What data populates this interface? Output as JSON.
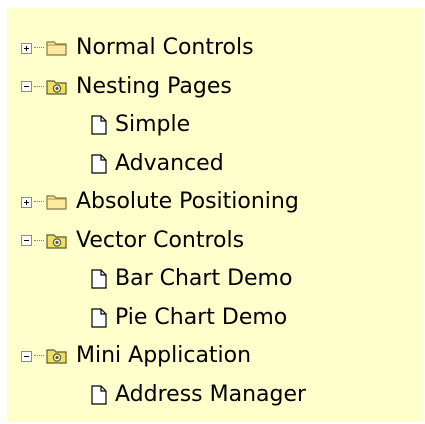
{
  "tree": {
    "items": [
      {
        "label": "Normal Controls",
        "state": "collapsed",
        "icon": "folder-icon"
      },
      {
        "label": "Nesting Pages",
        "state": "expanded",
        "icon": "open-folder-icon",
        "children": [
          {
            "label": "Simple",
            "icon": "page-icon"
          },
          {
            "label": "Advanced",
            "icon": "page-icon"
          }
        ]
      },
      {
        "label": "Absolute Positioning",
        "state": "collapsed",
        "icon": "folder-icon"
      },
      {
        "label": "Vector Controls",
        "state": "expanded",
        "icon": "open-folder-icon",
        "children": [
          {
            "label": "Bar Chart Demo",
            "icon": "page-icon"
          },
          {
            "label": "Pie Chart Demo",
            "icon": "page-icon"
          }
        ]
      },
      {
        "label": "Mini Application",
        "state": "expanded",
        "icon": "open-folder-icon",
        "children": [
          {
            "label": "Address Manager",
            "icon": "page-icon"
          }
        ]
      }
    ]
  },
  "colors": {
    "panel_background": "#ffffcc",
    "folder_fill": "#ffe99a",
    "folder_stroke": "#7f7a44",
    "open_folder_fill": "#f0e060"
  }
}
